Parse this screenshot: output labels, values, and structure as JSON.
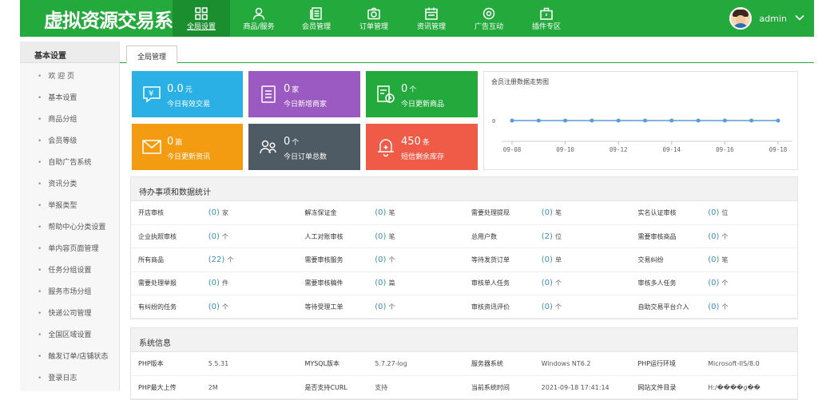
{
  "app": {
    "logo": "虚拟资源交易系统"
  },
  "nav": [
    {
      "label": "全局设置",
      "icon": "grid-icon"
    },
    {
      "label": "商品/服务",
      "icon": "user-icon"
    },
    {
      "label": "会员管理",
      "icon": "document-icon"
    },
    {
      "label": "订单管理",
      "icon": "camera-icon"
    },
    {
      "label": "资讯管理",
      "icon": "calendar-icon"
    },
    {
      "label": "广告互动",
      "icon": "gear-icon"
    },
    {
      "label": "插件专区",
      "icon": "briefcase-icon"
    }
  ],
  "user": {
    "name": "admin"
  },
  "sidebar": {
    "title": "基本设置",
    "items": [
      "欢 迎 页",
      "基本设置",
      "商品分组",
      "会员等级",
      "自助广告系统",
      "资讯分类",
      "举报类型",
      "帮助中心分类设置",
      "单内容页面管理",
      "任务分组设置",
      "服务市场分组",
      "快递公司管理",
      "全国区域设置",
      "触发订单/店铺状态",
      "登录日志"
    ]
  },
  "tab": "全局管理",
  "cards": [
    {
      "value": "0.0",
      "unit": "元",
      "title": "今日有效交易",
      "color": "#2bb0e6",
      "icon": "yen-icon"
    },
    {
      "value": "0",
      "unit": "家",
      "title": "今日新增商家",
      "color": "#9b59c2",
      "icon": "list-icon"
    },
    {
      "value": "0",
      "unit": "个",
      "title": "今日更新商品",
      "color": "#24a93c",
      "icon": "clock-doc-icon"
    },
    {
      "value": "0",
      "unit": "篇",
      "title": "今日更新资讯",
      "color": "#f39c12",
      "icon": "mail-icon"
    },
    {
      "value": "0",
      "unit": "个",
      "title": "今日订单总数",
      "color": "#4e5a64",
      "icon": "people-icon"
    },
    {
      "value": "450",
      "unit": "条",
      "title": "短信剩余库存",
      "color": "#ef5b47",
      "icon": "bell-icon"
    }
  ],
  "chart_data": {
    "type": "line",
    "title": "会员注册数据走势图",
    "x": [
      "09-08",
      "09-09",
      "09-10",
      "09-11",
      "09-12",
      "09-13",
      "09-14",
      "09-15",
      "09-16",
      "09-17",
      "09-18"
    ],
    "x_tick_labels": [
      "09-08",
      "09-10",
      "09-12",
      "09-14",
      "09-16",
      "09-18"
    ],
    "y_tick_labels": [
      "0"
    ],
    "series": [
      {
        "values": [
          0,
          0,
          0,
          0,
          0,
          0,
          0,
          0,
          0,
          0,
          0
        ]
      }
    ],
    "grid": false
  },
  "todo": {
    "title": "待办事项和数据统计",
    "rows": [
      [
        {
          "label": "开店审核",
          "n": "(0)",
          "u": "家"
        },
        {
          "label": "解冻保证金",
          "n": "(0)",
          "u": "笔"
        },
        {
          "label": "需要处理提现",
          "n": "(0)",
          "u": "笔"
        },
        {
          "label": "实名认证审核",
          "n": "(0)",
          "u": "位"
        }
      ],
      [
        {
          "label": "企业执照审核",
          "n": "(0)",
          "u": "个"
        },
        {
          "label": "人工对账审核",
          "n": "(0)",
          "u": "笔"
        },
        {
          "label": "总用户数",
          "n": "(2)",
          "u": "位"
        },
        {
          "label": "需要审核商品",
          "n": "(0)",
          "u": "个"
        }
      ],
      [
        {
          "label": "所有商品",
          "n": "(22)",
          "u": "个"
        },
        {
          "label": "需要审核服务",
          "n": "(0)",
          "u": "个"
        },
        {
          "label": "等待发货订单",
          "n": "(0)",
          "u": "单"
        },
        {
          "label": "交易纠纷",
          "n": "(0)",
          "u": "笔"
        }
      ],
      [
        {
          "label": "需要处理举报",
          "n": "(0)",
          "u": "件"
        },
        {
          "label": "需要审核稿件",
          "n": "(0)",
          "u": "篇"
        },
        {
          "label": "审核单人任务",
          "n": "(0)",
          "u": "个"
        },
        {
          "label": "审核多人任务",
          "n": "(0)",
          "u": "个"
        }
      ],
      [
        {
          "label": "有纠纷的任务",
          "n": "(0)",
          "u": "个"
        },
        {
          "label": "等待受理工单",
          "n": "(0)",
          "u": "个"
        },
        {
          "label": "审核资讯评价",
          "n": "(0)",
          "u": "个"
        },
        {
          "label": "自助交易平台介入",
          "n": "(0)",
          "u": "个"
        }
      ]
    ]
  },
  "sysinfo": {
    "title": "系统信息",
    "rows": [
      [
        {
          "label": "PHP版本",
          "value": "5.5.31"
        },
        {
          "label": "MYSQL版本",
          "value": "5.7.27-log"
        },
        {
          "label": "服务器系统",
          "value": "Windows NT6.2"
        },
        {
          "label": "PHP运行环境",
          "value": "Microsoft-IIS/8.0"
        }
      ],
      [
        {
          "label": "PHP最大上传",
          "value": "2M"
        },
        {
          "label": "是否支持CURL",
          "value": "支持"
        },
        {
          "label": "当前系统时间",
          "value": "2021-09-18 17:41:14"
        },
        {
          "label": "网站文件目录",
          "value": "H:/����ɡ��"
        }
      ]
    ]
  }
}
